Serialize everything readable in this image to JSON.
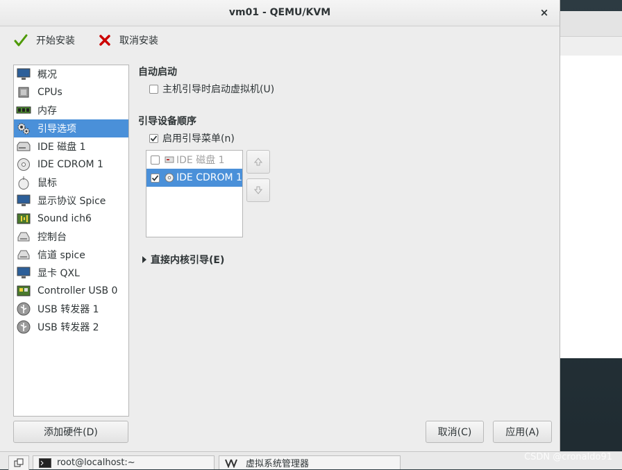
{
  "window": {
    "title": "vm01 - QEMU/KVM",
    "close_glyph": "×"
  },
  "toolbar": {
    "begin_install": "开始安装",
    "cancel_install": "取消安装"
  },
  "sidebar": {
    "items": [
      {
        "label": "概况",
        "icon": "monitor-icon"
      },
      {
        "label": "CPUs",
        "icon": "cpu-icon"
      },
      {
        "label": "内存",
        "icon": "memory-icon"
      },
      {
        "label": "引导选项",
        "icon": "gears-icon",
        "selected": true
      },
      {
        "label": "IDE 磁盘 1",
        "icon": "disk-icon"
      },
      {
        "label": "IDE CDROM 1",
        "icon": "cdrom-icon"
      },
      {
        "label": "鼠标",
        "icon": "mouse-icon"
      },
      {
        "label": "显示协议 Spice",
        "icon": "display-icon"
      },
      {
        "label": "Sound ich6",
        "icon": "sound-icon"
      },
      {
        "label": "控制台",
        "icon": "serial-icon"
      },
      {
        "label": "信道 spice",
        "icon": "channel-icon"
      },
      {
        "label": "显卡 QXL",
        "icon": "video-icon"
      },
      {
        "label": "Controller USB 0",
        "icon": "controller-icon"
      },
      {
        "label": "USB 转发器 1",
        "icon": "usb-icon"
      },
      {
        "label": "USB 转发器 2",
        "icon": "usb-icon"
      }
    ],
    "add_hardware": "添加硬件(D)"
  },
  "autostart": {
    "title": "自动启动",
    "checkbox_label": "主机引导时启动虚拟机(U)",
    "checked": false
  },
  "boot_order": {
    "title": "引导设备顺序",
    "menu_label": "启用引导菜单(n)",
    "menu_checked": true,
    "devices": [
      {
        "label": "IDE 磁盘 1",
        "checked": false,
        "selected": false,
        "icon": "disk-icon"
      },
      {
        "label": "IDE CDROM 1",
        "checked": true,
        "selected": true,
        "icon": "cdrom-icon"
      }
    ]
  },
  "direct_kernel": {
    "label": "直接内核引导(E)"
  },
  "buttons": {
    "cancel": "取消(C)",
    "apply": "应用(A)"
  },
  "taskbar": {
    "terminal": "root@localhost:~",
    "vmm": "虚拟系统管理器"
  },
  "watermark": "CSDN @cronaldo91",
  "colors": {
    "selection": "#4a90d9",
    "check_green": "#4e9a06",
    "cancel_red": "#cc0000"
  }
}
